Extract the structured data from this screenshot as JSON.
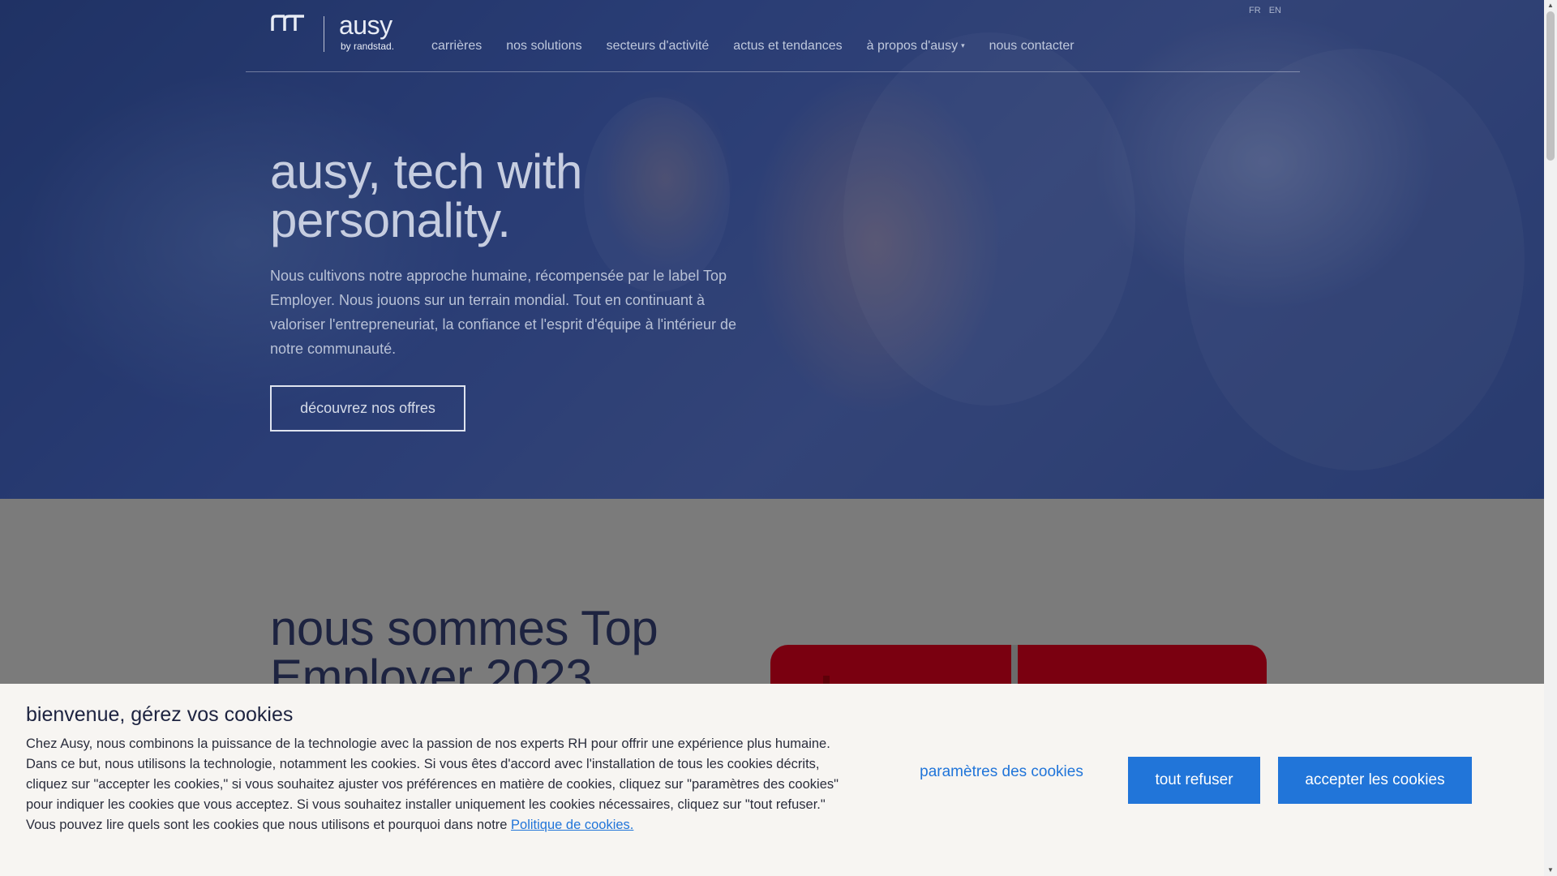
{
  "header": {
    "logo": {
      "word": "ausy",
      "sub": "by randstad."
    },
    "nav": [
      {
        "label": "carrières"
      },
      {
        "label": "nos solutions"
      },
      {
        "label": "secteurs d'activité"
      },
      {
        "label": "actus et tendances"
      },
      {
        "label": "à propos d'ausy"
      },
      {
        "label": "nous contacter"
      }
    ],
    "languages": [
      "FR",
      "EN"
    ]
  },
  "hero": {
    "title": "ausy, tech with personality.",
    "text": "Nous cultivons notre approche humaine, récompensée par le label Top Employer. Nous jouons sur un terrain mondial. Tout en continuant à valoriser l'entrepreneuriat, la confiance et l'esprit d'équipe à l'intérieur de notre communauté.",
    "cta": "découvrez nos offres"
  },
  "section2": {
    "title": "nous sommes Top Employer 2023"
  },
  "cookie_banner": {
    "title": "bienvenue, gérez vos cookies",
    "text": "Chez Ausy, nous combinons la puissance de la technologie avec la passion de nos experts RH pour offrir une expérience plus humaine. Dans ce but, nous utilisons la technologie, notamment les cookies. Si vous êtes d'accord avec l'installation de tous les cookies décrits, cliquez sur \"accepter les cookies,\" si vous souhaitez ajuster vos préférences en matière de cookies, cliquez sur \"paramètres des cookies\" pour indiquer les cookies que vous acceptez. Si vous souhaitez installer uniquement les cookies nécessaires, cliquez sur \"tout refuser.\" Vous pouvez lire quels sont les cookies que nous utilisons et pourquoi dans notre ",
    "link": "Politique de cookies.",
    "settings_label": "paramètres des cookies",
    "refuse_label": "tout refuser",
    "accept_label": "accepter les cookies"
  },
  "colors": {
    "accent": "#2175d9",
    "hero_overlay": "#1e2e66",
    "heading_dark": "#1d2340",
    "banner_bg": "#f7f5f2"
  },
  "icons": [
    "randstad-logo-icon",
    "caret-down-icon",
    "scroll-up-icon",
    "scroll-down-icon"
  ]
}
